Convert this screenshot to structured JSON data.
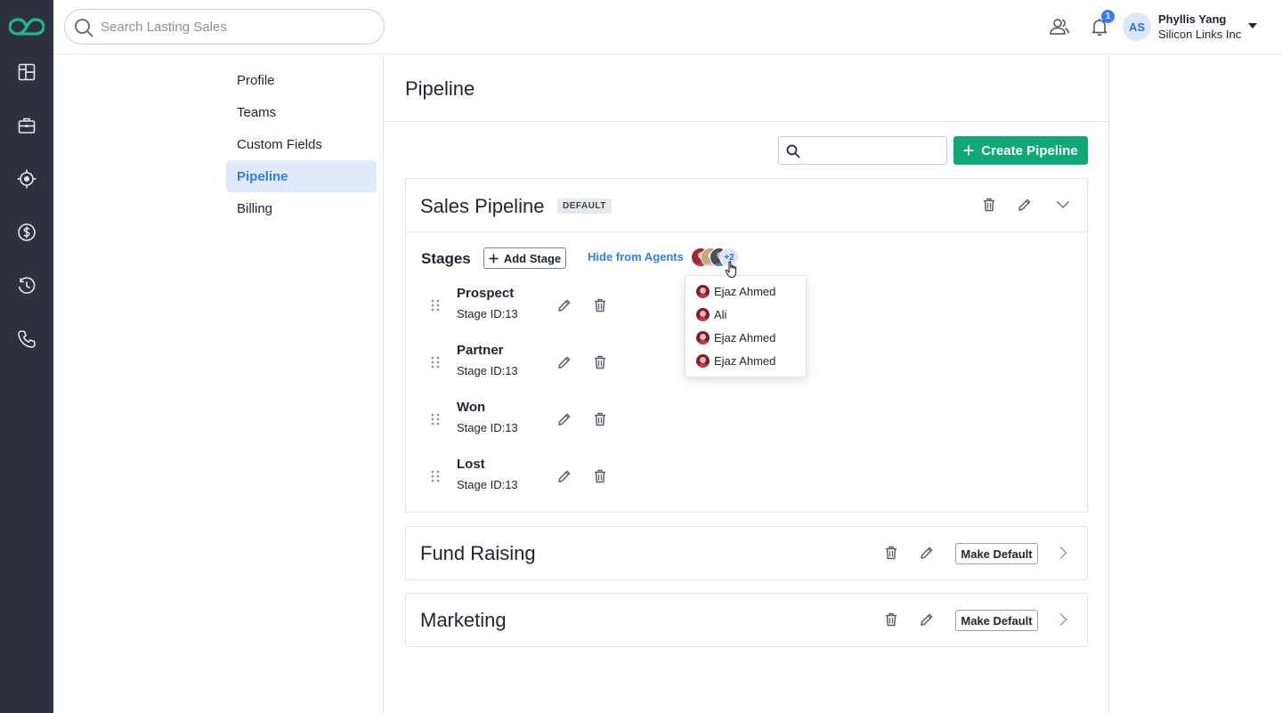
{
  "topbar": {
    "search_placeholder": "Search Lasting Sales",
    "notification_count": "1",
    "user": {
      "initials": "AS",
      "name": "Phyllis Yang",
      "org": "Silicon Links Inc"
    }
  },
  "rail": {
    "icons": [
      "dashboard-icon",
      "briefcase-icon",
      "target-icon",
      "dollar-icon",
      "history-icon",
      "phone-icon"
    ]
  },
  "subnav": {
    "items": [
      {
        "label": "Profile",
        "active": false
      },
      {
        "label": "Teams",
        "active": false
      },
      {
        "label": "Custom Fields",
        "active": false
      },
      {
        "label": "Pipeline",
        "active": true
      },
      {
        "label": "Billing",
        "active": false
      }
    ]
  },
  "main": {
    "title": "Pipeline",
    "search_value": "",
    "create_label": "Create Pipeline",
    "pipelines": [
      {
        "name": "Sales Pipeline",
        "badge": "DEFAULT",
        "expanded": true,
        "stages_label": "Stages",
        "add_stage_label": "Add Stage",
        "hide_agents_label": "Hide from Agents",
        "more_agents": "+2",
        "stages": [
          {
            "name": "Prospect",
            "id": "Stage ID:13"
          },
          {
            "name": "Partner",
            "id": "Stage ID:13"
          },
          {
            "name": "Won",
            "id": "Stage ID:13"
          },
          {
            "name": "Lost",
            "id": "Stage ID:13"
          }
        ]
      },
      {
        "name": "Fund Raising",
        "make_default_label": "Make Default",
        "expanded": false
      },
      {
        "name": "Marketing",
        "make_default_label": "Make Default",
        "expanded": false
      }
    ]
  },
  "agents_popover": {
    "items": [
      "Ejaz Ahmed",
      "Ali",
      "Ejaz Ahmed",
      "Ejaz Ahmed"
    ]
  },
  "colors": {
    "rail_bg": "#2d323e",
    "accent_blue": "#2f7cf6",
    "create_green": "#0fa978",
    "logo_teal": "#1fb58f"
  }
}
